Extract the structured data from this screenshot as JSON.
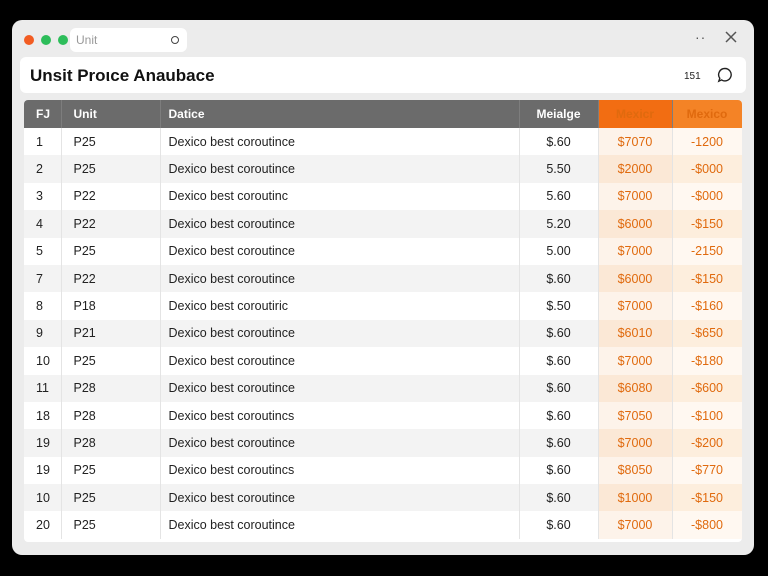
{
  "tab": {
    "label": "Unit"
  },
  "header": {
    "title": "Unsit Proιce Anaubace",
    "count": "151"
  },
  "table": {
    "columns": [
      "FJ",
      "Unit",
      "Datice",
      "Meialge",
      "Mexicr",
      "Mexico"
    ],
    "rows": [
      [
        "1",
        "P25",
        "Dexico best corоutince",
        "$.60",
        "$7070",
        "-1200"
      ],
      [
        "2",
        "P25",
        "Dexico best coroutince",
        "5.50",
        "$2000",
        "-$000"
      ],
      [
        "3",
        "P22",
        "Dexico best coroutinc",
        "5.60",
        "$7000",
        "-$000"
      ],
      [
        "4",
        "P22",
        "Dexico best coroutince",
        "5.20",
        "$6000",
        "-$150"
      ],
      [
        "5",
        "P25",
        "Dexico best coroutince",
        "5.00",
        "$7000",
        "-2150"
      ],
      [
        "7",
        "P22",
        "Dexico best coroutince",
        "$.60",
        "$6000",
        "-$150"
      ],
      [
        "8",
        "P18",
        "Dexico best coroutiric",
        "$.50",
        "$7000",
        "-$160"
      ],
      [
        "9",
        "P21",
        "Dexico best coroutince",
        "$.60",
        "$6010",
        "-$650"
      ],
      [
        "10",
        "P25",
        "Dexico best coroutince",
        "$.60",
        "$7000",
        "-$180"
      ],
      [
        "11",
        "P28",
        "Dexico best coroutince",
        "$.60",
        "$6080",
        "-$600"
      ],
      [
        "18",
        "P28",
        "Dexico best coroutincs",
        "$.60",
        "$7050",
        "-$100"
      ],
      [
        "19",
        "P28",
        "Dexico best coroutince",
        "$.60",
        "$7000",
        "-$200"
      ],
      [
        "19",
        "P25",
        "Dexico best coroutincs",
        "$.60",
        "$8050",
        "-$770"
      ],
      [
        "10",
        "P25",
        "Dexico best coroutince",
        "$.60",
        "$1000",
        "-$150"
      ],
      [
        "20",
        "P25",
        "Dexico best coroutince",
        "$.60",
        "$7000",
        "-$800"
      ]
    ]
  },
  "icons": {
    "window_close": "close-icon",
    "more": "more-icon",
    "chat": "chat-icon"
  },
  "colors": {
    "accent": "#f26d12",
    "header_gray": "#6b6b6b",
    "dot_red": "#f25c22",
    "dot_green": "#2dbd5a"
  }
}
